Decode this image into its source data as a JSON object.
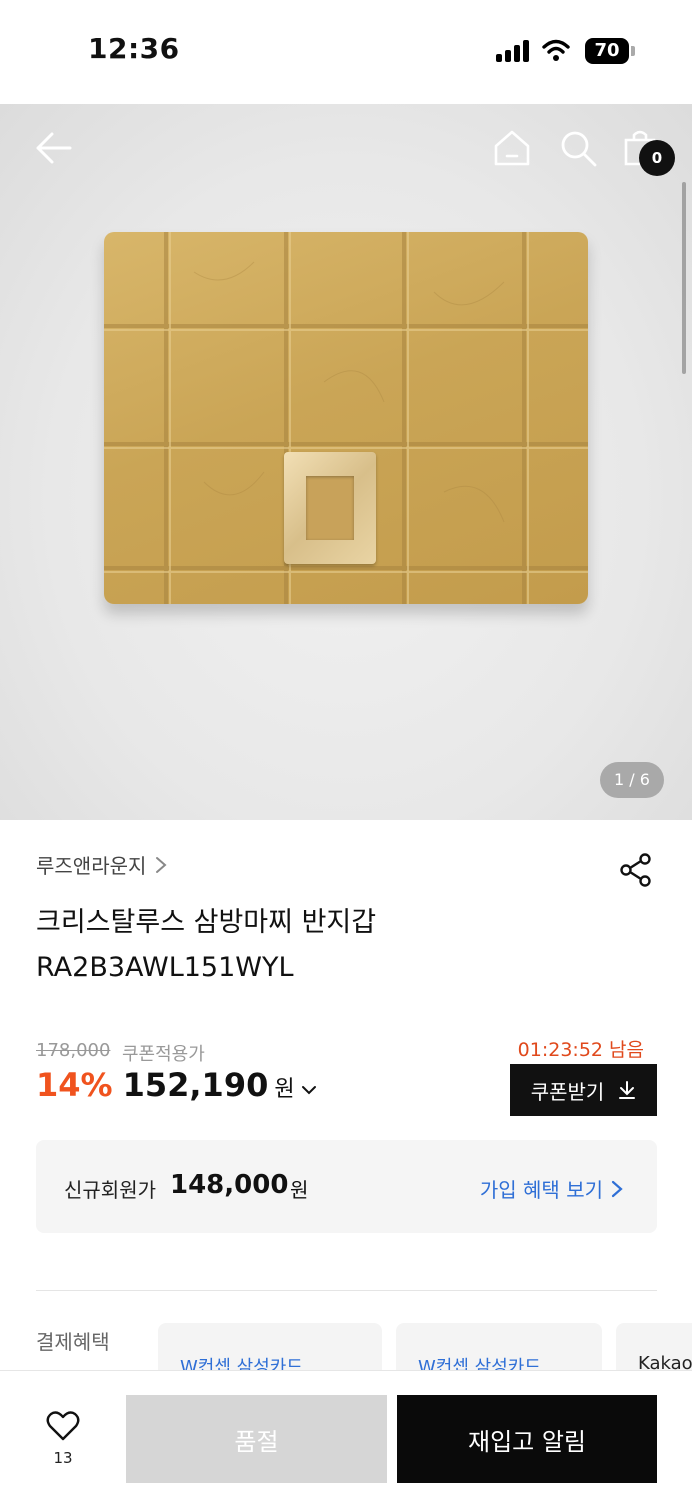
{
  "status_bar": {
    "time": "12:36",
    "battery": "70"
  },
  "header": {
    "back_icon": "arrow-left-icon",
    "home_icon": "home-icon",
    "search_icon": "search-icon",
    "bag_icon": "shopping-bag-icon",
    "cart_count": "0"
  },
  "gallery": {
    "counter": "1 / 6"
  },
  "product": {
    "brand": "루즈앤라운지",
    "name_line1": "크리스탈루스 삼방마찌 반지갑",
    "name_line2": "RA2B3AWL151WYL"
  },
  "price": {
    "original": "178,000",
    "coupon_label": "쿠폰적용가",
    "countdown": "01:23:52 남음",
    "discount": "14%",
    "sale": "152,190",
    "unit": "원",
    "coupon_button": "쿠폰받기"
  },
  "member": {
    "label": "신규회원가",
    "price": "148,000",
    "unit": "원",
    "link": "가입 혜택 보기"
  },
  "payment": {
    "label": "결제혜택",
    "cards": [
      "W컨셉 삼성카드",
      "W컨셉 삼성카드",
      "Kakao"
    ]
  },
  "bottom_bar": {
    "like_count": "13",
    "soldout": "품절",
    "restock": "재입고 알림"
  },
  "colors": {
    "accent_orange": "#f0531e",
    "countdown_red": "#e0491c",
    "link_blue": "#2f6fd6",
    "primary_black": "#0a0a0a"
  }
}
